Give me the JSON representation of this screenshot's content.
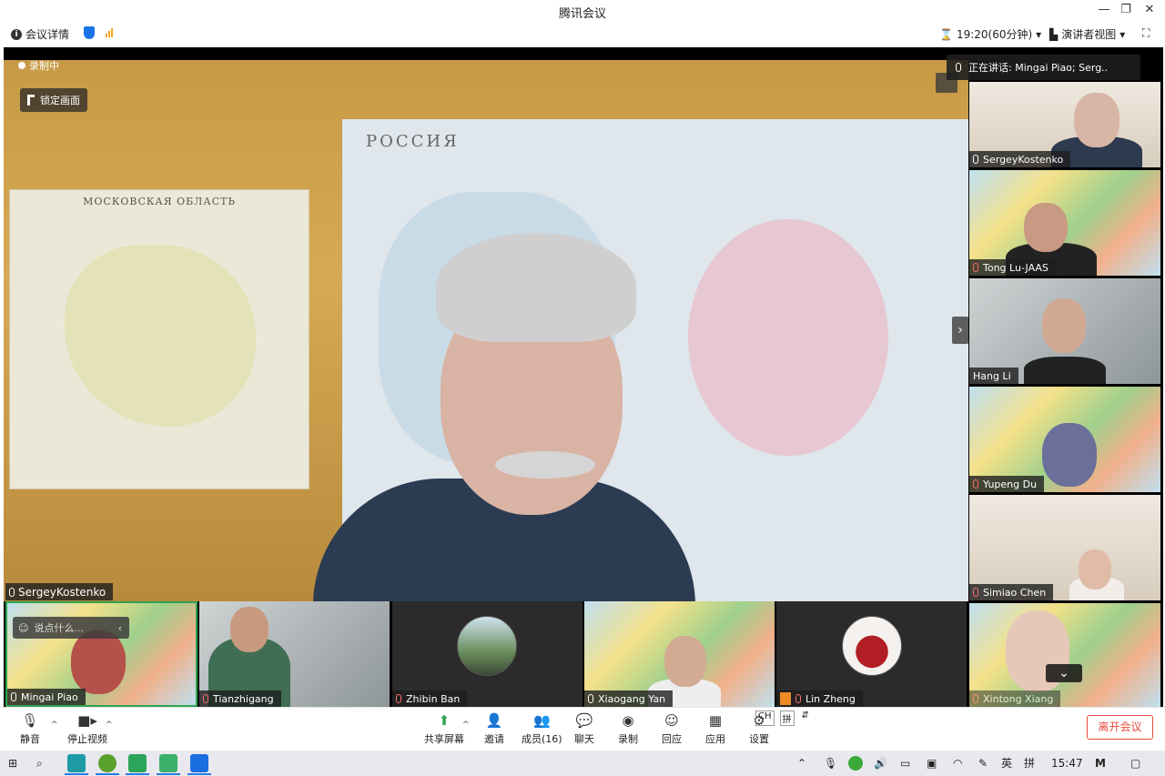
{
  "window": {
    "title": "腾讯会议"
  },
  "infobar": {
    "meeting_details": "会议详情",
    "time": "19:20(60分钟)",
    "view_mode": "演讲者视图"
  },
  "main": {
    "recording": "录制中",
    "lock": "锁定画面",
    "speaker_name": "SergeyKostenko",
    "map_left_title": "МОСКОВСКАЯ ОБЛАСТЬ",
    "map_right_title": "РОССИЯ",
    "speaking": "正在讲话:  Mingai Piao; Serg.."
  },
  "side_tiles": [
    {
      "name": "SergeyKostenko",
      "muted": false
    },
    {
      "name": "Tong Lu-JAAS",
      "muted": true
    },
    {
      "name": "Hang Li",
      "muted": false
    },
    {
      "name": "Yupeng Du",
      "muted": true
    },
    {
      "name": "Simiao Chen",
      "muted": true
    },
    {
      "name": "Xintong Xiang",
      "muted": true
    }
  ],
  "bottom_tiles": [
    {
      "name": "Mingai Piao",
      "muted": false
    },
    {
      "name": "Tianzhigang",
      "muted": true
    },
    {
      "name": "Zhibin Ban",
      "muted": true
    },
    {
      "name": "Xiaogang Yan",
      "muted": false
    },
    {
      "name": "Lin Zheng",
      "muted": true
    }
  ],
  "chat_float": {
    "placeholder": "说点什么..."
  },
  "toolbar": {
    "mute": "静音",
    "stop_video": "停止视频",
    "share": "共享屏幕",
    "invite": "邀请",
    "members": "成员(16)",
    "chat": "聊天",
    "record": "录制",
    "react": "回应",
    "apps": "应用",
    "settings": "设置",
    "leave": "离开会议",
    "ime_ch": "CH",
    "ime_layout": "拼"
  },
  "taskbar": {
    "time": "15:47",
    "lang": "英",
    "ime": "拼"
  },
  "colors": {
    "accent_green": "#2ea44f",
    "leave_red": "#e74c3c",
    "active_border": "#2ea44f"
  }
}
